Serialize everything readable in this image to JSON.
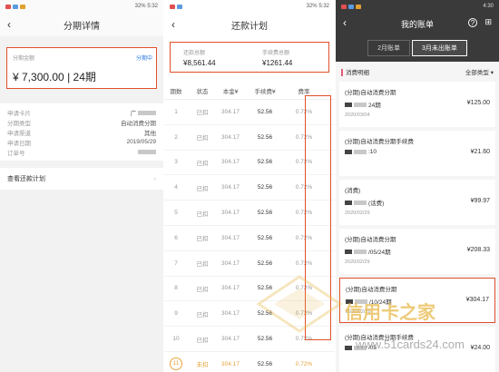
{
  "panel1": {
    "status_time": "5:32",
    "status_battery": "32%",
    "title": "分期详情",
    "amount_label": "分期金额",
    "amount_link": "分期中",
    "amount_value": "¥ 7,300.00",
    "period": "24期",
    "info": [
      {
        "label": "申请卡片",
        "value": "广"
      },
      {
        "label": "分期类型",
        "value": "自动消费分期"
      },
      {
        "label": "申请渠道",
        "value": "其他"
      },
      {
        "label": "申请日期",
        "value": "2019/05/29"
      },
      {
        "label": "订单号",
        "value": ""
      }
    ],
    "plan_link": "查看还款计划"
  },
  "panel2": {
    "status_time": "5:32",
    "status_battery": "32%",
    "title": "还款计划",
    "total_repay_label": "还款总额",
    "total_repay": "¥8,561.44",
    "total_fee_label": "手续费总额",
    "total_fee": "¥1261.44",
    "headers": [
      "期数",
      "状态",
      "本金¥",
      "手续费¥",
      "费率"
    ],
    "rows": [
      [
        "1",
        "已扣",
        "304.17",
        "52.56",
        "0.72%"
      ],
      [
        "2",
        "已扣",
        "304.17",
        "52.56",
        "0.72%"
      ],
      [
        "3",
        "已扣",
        "304.17",
        "52.56",
        "0.72%"
      ],
      [
        "4",
        "已扣",
        "304.17",
        "52.56",
        "0.72%"
      ],
      [
        "5",
        "已扣",
        "304.17",
        "52.56",
        "0.72%"
      ],
      [
        "6",
        "已扣",
        "304.17",
        "52.56",
        "0.72%"
      ],
      [
        "7",
        "已扣",
        "304.17",
        "52.56",
        "0.72%"
      ],
      [
        "8",
        "已扣",
        "304.17",
        "52.56",
        "0.72%"
      ],
      [
        "9",
        "已扣",
        "304.17",
        "52.56",
        "0.72%"
      ],
      [
        "10",
        "已扣",
        "304.17",
        "52.56",
        "0.72%"
      ],
      [
        "11",
        "未扣",
        "304.17",
        "52.56",
        "0.72%"
      ]
    ]
  },
  "panel3": {
    "status_time": "4:30",
    "title": "我的账单",
    "tabs": [
      "2月账单",
      "3月未出账单"
    ],
    "section": "消费明细",
    "filter": "全部类型",
    "items": [
      {
        "name": "(分期)自动消费分期",
        "sub": "24期",
        "date": "2020/03/04",
        "amount": "¥125.00"
      },
      {
        "name": "(分期)自动消费分期手续费",
        "sub": ":10",
        "date": "",
        "amount": "¥21.60"
      },
      {
        "name": "(消费)",
        "sub": "(话费)",
        "date": "2020/02/29",
        "amount": "¥99.97"
      },
      {
        "name": "(分期)自动消费分期",
        "sub": "/05/24期",
        "date": "2020/02/29",
        "amount": "¥208.33"
      },
      {
        "name": "(分期)自动消费分期",
        "sub": "/10/24期",
        "date": "2020/02/29",
        "amount": "¥304.17"
      },
      {
        "name": "(分期)自动消费分期手续费",
        "sub": "/05",
        "date": "",
        "amount": "¥24.00"
      }
    ]
  },
  "watermark": {
    "text": "信用卡之家",
    "url": "www.51cards24.com"
  }
}
